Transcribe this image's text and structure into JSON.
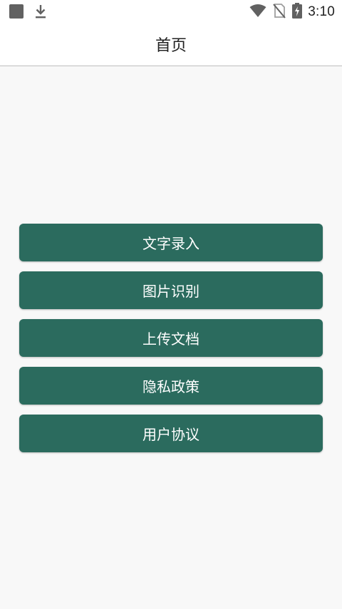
{
  "status_bar": {
    "time": "3:10",
    "icons": [
      "app-square-icon",
      "download-icon",
      "wifi-icon",
      "no-sim-icon",
      "battery-charging-icon"
    ]
  },
  "app_bar": {
    "title": "首页"
  },
  "menu": {
    "items": [
      {
        "label": "文字录入",
        "icon": ""
      },
      {
        "label": "图片识别",
        "icon": ""
      },
      {
        "label": "上传文档",
        "icon": ""
      },
      {
        "label": "隐私政策",
        "icon": ""
      },
      {
        "label": "用户协议",
        "icon": ""
      }
    ]
  },
  "colors": {
    "button_bg": "#2b6b5e",
    "page_bg": "#f8f8f8",
    "appbar_bg": "#ffffff"
  }
}
